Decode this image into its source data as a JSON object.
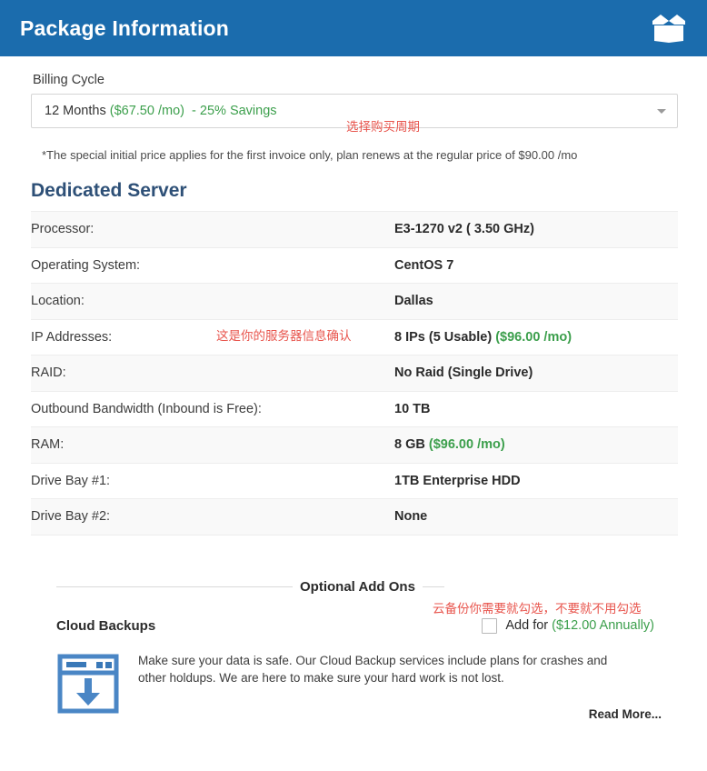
{
  "header": {
    "title": "Package Information",
    "icon": "open-box-icon"
  },
  "billing": {
    "label": "Billing Cycle",
    "selected_term": "12 Months",
    "selected_price": "($67.50 /mo)",
    "selected_savings": "- 25% Savings",
    "caret_icon": "chevron-down-icon",
    "disclaimer": "*The special initial price applies for the first invoice only, plan renews at the regular price of $90.00 /mo"
  },
  "annotations": {
    "billing": "选择购买周期",
    "server": "这是你的服务器信息确认",
    "backup": "云备份你需要就勾选，不要就不用勾选",
    "color": "#e8554d"
  },
  "server": {
    "title": "Dedicated Server",
    "rows": [
      {
        "key": "Processor:",
        "value": "E3-1270 v2 ( 3.50 GHz)",
        "price": ""
      },
      {
        "key": "Operating System:",
        "value": "CentOS 7",
        "price": ""
      },
      {
        "key": "Location:",
        "value": "Dallas",
        "price": ""
      },
      {
        "key": "IP Addresses:",
        "value": "8 IPs (5 Usable)",
        "price": "($96.00 /mo)"
      },
      {
        "key": "RAID:",
        "value": "No Raid (Single Drive)",
        "price": ""
      },
      {
        "key": "Outbound Bandwidth (Inbound is Free):",
        "value": "10 TB",
        "price": ""
      },
      {
        "key": "RAM:",
        "value": "8 GB",
        "price": "($96.00 /mo)"
      },
      {
        "key": "Drive Bay #1:",
        "value": "1TB Enterprise HDD",
        "price": ""
      },
      {
        "key": "Drive Bay #2:",
        "value": "None",
        "price": ""
      }
    ]
  },
  "addons": {
    "title": "Optional Add Ons",
    "name": "Cloud Backups",
    "checkbox_checked": false,
    "add_label": "Add for",
    "add_price": "($12.00 Annually)",
    "icon": "cloud-backup-download-icon",
    "description": "Make sure your data is safe. Our Cloud Backup services include plans for crashes and other holdups. We are here to make sure your hard work is not lost.",
    "read_more": "Read More..."
  },
  "colors": {
    "header_blue": "#1b6cad",
    "heading_blue": "#2e5077",
    "price_green": "#3c9f4c",
    "annotation_red": "#e8554d",
    "icon_blue": "#4a86c5"
  }
}
